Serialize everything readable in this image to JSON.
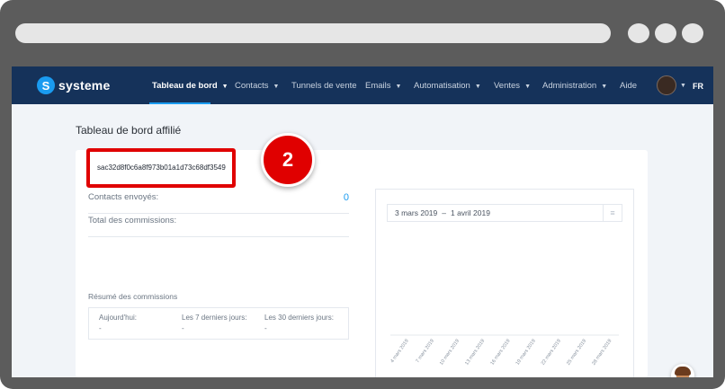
{
  "app": {
    "name": "systeme"
  },
  "nav": {
    "items": [
      {
        "label": "Tableau de bord",
        "chevron": true,
        "active": true
      },
      {
        "label": "Contacts",
        "chevron": true,
        "active": false
      },
      {
        "label": "Tunnels de vente",
        "chevron": false,
        "active": false
      },
      {
        "label": "Emails",
        "chevron": true,
        "active": false
      },
      {
        "label": "Automatisation",
        "chevron": true,
        "active": false
      },
      {
        "label": "Ventes",
        "chevron": true,
        "active": false
      },
      {
        "label": "Administration",
        "chevron": true,
        "active": false
      },
      {
        "label": "Aide",
        "chevron": false,
        "active": false
      }
    ],
    "language": "FR"
  },
  "page": {
    "title": "Tableau de bord affilié",
    "affiliate_id": "sac32d8f0c6a8f973b01a1d73c68df3549",
    "step_badge": "2",
    "contacts_label": "Contacts envoyés:",
    "contacts_value": "0",
    "commissions_label": "Total des commissions:",
    "summary_title": "Résumé des commissions",
    "summary": [
      {
        "label": "Aujourd'hui:",
        "value": "-"
      },
      {
        "label": "Les 7 derniers jours:",
        "value": "-"
      },
      {
        "label": "Les 30 derniers jours:",
        "value": "-"
      }
    ]
  },
  "chart": {
    "date_from": "3 mars 2019",
    "date_separator": "–",
    "date_to": "1 avril 2019"
  },
  "chart_data": {
    "type": "bar",
    "categories": [
      "4 mars 2019",
      "7 mars 2019",
      "10 mars 2019",
      "13 mars 2019",
      "16 mars 2019",
      "19 mars 2019",
      "22 mars 2019",
      "25 mars 2019",
      "28 mars 2019"
    ],
    "values": [
      0,
      0,
      0,
      0,
      0,
      0,
      0,
      0,
      0
    ],
    "title": "",
    "xlabel": "",
    "ylabel": "",
    "grid": false
  },
  "colors": {
    "nav_bg": "#15325a",
    "accent": "#1a9bf0",
    "highlight": "#e00000"
  },
  "icons": {
    "logo": "systeme-logo-icon",
    "date_menu": "hamburger-icon",
    "chevron": "chevron-down-icon"
  }
}
